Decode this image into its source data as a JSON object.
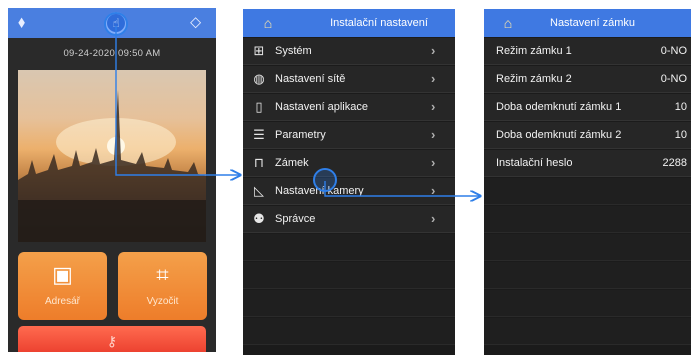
{
  "home": {
    "datetime": "09-24-2020 09:50 AM",
    "top_icons": {
      "left": "⬧",
      "center": "☝",
      "right": "⬦"
    },
    "tiles": [
      {
        "label": "Adresář",
        "icon": "▣"
      },
      {
        "label": "Vyzočit",
        "icon": "⌗"
      }
    ],
    "bottom_icon": "⚷"
  },
  "install": {
    "title": "Instalační nastavení",
    "home_icon": "⌂",
    "items": [
      {
        "label": "Systém",
        "icon": "⊞",
        "icon_name": "grid-icon"
      },
      {
        "label": "Nastavení sítě",
        "icon": "◍",
        "icon_name": "globe-icon"
      },
      {
        "label": "Nastavení aplikace",
        "icon": "▯",
        "icon_name": "phone-icon"
      },
      {
        "label": "Parametry",
        "icon": "☰",
        "icon_name": "sliders-icon"
      },
      {
        "label": "Zámek",
        "icon": "⊓",
        "icon_name": "lock-icon"
      },
      {
        "label": "Nastavení kamery",
        "icon": "◺",
        "icon_name": "camera-icon"
      },
      {
        "label": "Správce",
        "icon": "⚉",
        "icon_name": "admin-icon"
      }
    ],
    "chevron": "›"
  },
  "lock": {
    "title": "Nastavení zámku",
    "home_icon": "⌂",
    "rows": [
      {
        "label": "Režim zámku 1",
        "value": "0-NO"
      },
      {
        "label": "Režim zámku 2",
        "value": "0-NO"
      },
      {
        "label": "Doba odemknutí zámku 1",
        "value": "10"
      },
      {
        "label": "Doba odemknutí zámku 2",
        "value": "10"
      },
      {
        "label": "Instalační heslo",
        "value": "2288"
      }
    ]
  },
  "colors": {
    "header_blue": "#3f79e2",
    "tile_orange": "#ee7d2a",
    "bar_red": "#ea3c2c",
    "arrow_blue": "#2f7fe8"
  }
}
